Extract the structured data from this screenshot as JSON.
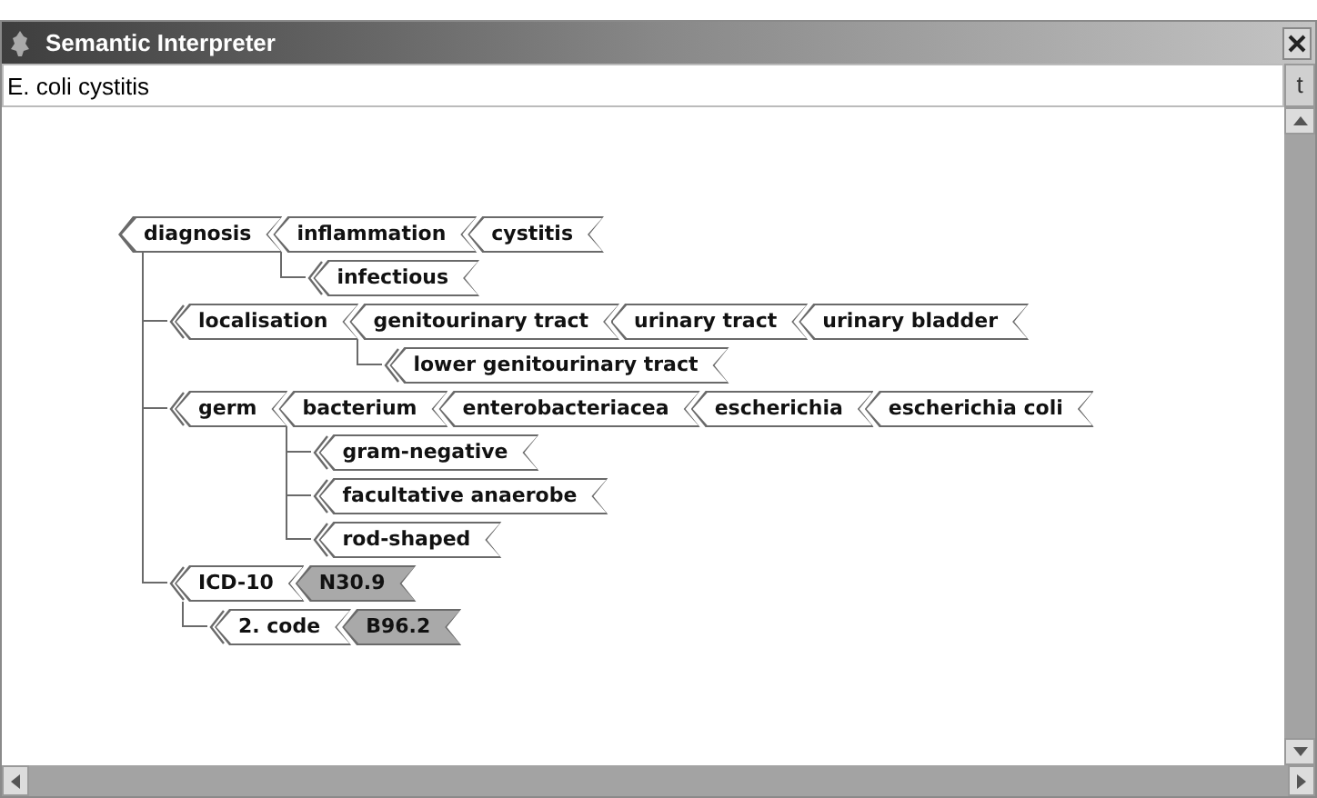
{
  "window": {
    "title": "Semantic Interpreter"
  },
  "query": {
    "value": "E. coli cystitis",
    "button": "t"
  },
  "tree": {
    "label": "diagnosis",
    "kind": "term",
    "next": {
      "label": "inflammation",
      "kind": "term",
      "next": {
        "label": "cystitis",
        "kind": "term"
      },
      "children": [
        {
          "label": "infectious",
          "kind": "term"
        }
      ]
    },
    "children": [
      {
        "label": "localisation",
        "kind": "term",
        "next": {
          "label": "genitourinary tract",
          "kind": "term",
          "next": {
            "label": "urinary tract",
            "kind": "term",
            "next": {
              "label": "urinary bladder",
              "kind": "term"
            }
          },
          "children": [
            {
              "label": "lower genitourinary tract",
              "kind": "term"
            }
          ]
        }
      },
      {
        "label": "germ",
        "kind": "term",
        "next": {
          "label": "bacterium",
          "kind": "term",
          "next": {
            "label": "enterobacteriacea",
            "kind": "term",
            "next": {
              "label": "escherichia",
              "kind": "term",
              "next": {
                "label": "escherichia coli",
                "kind": "term"
              }
            }
          },
          "children": [
            {
              "label": "gram-negative",
              "kind": "term"
            },
            {
              "label": "facultative anaerobe",
              "kind": "term"
            },
            {
              "label": "rod-shaped",
              "kind": "term"
            }
          ]
        }
      },
      {
        "label": "ICD-10",
        "kind": "term",
        "next": {
          "label": "N30.9",
          "kind": "code"
        },
        "children": [
          {
            "label": "2. code",
            "kind": "term",
            "next": {
              "label": "B96.2",
              "kind": "code"
            }
          }
        ]
      }
    ]
  }
}
